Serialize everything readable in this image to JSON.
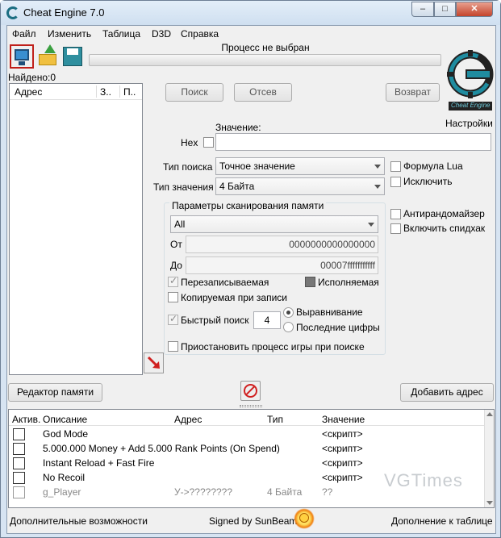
{
  "window": {
    "title": "Cheat Engine 7.0",
    "min": "–",
    "max": "□",
    "close": "✕"
  },
  "menu": [
    "Файл",
    "Изменить",
    "Таблица",
    "D3D",
    "Справка"
  ],
  "process_label": "Процесс не выбран",
  "found_label": "Найдено:0",
  "logo_text": "Cheat Engine",
  "settings_label": "Настройки",
  "results_headers": [
    "Адрес",
    "З..",
    "П.."
  ],
  "buttons": {
    "scan": "Поиск",
    "filter": "Отсев",
    "undo": "Возврат",
    "memory_view": "Редактор памяти",
    "add_address": "Добавить адрес"
  },
  "value": {
    "label": "Значение:",
    "hex_label": "Hex",
    "current": ""
  },
  "scan_type": {
    "label": "Тип поиска",
    "selected": "Точное значение"
  },
  "value_type": {
    "label": "Тип значения",
    "selected": "4 Байта"
  },
  "options_right": {
    "lua_formula": "Формула Lua",
    "not": "Исключить",
    "unrandomizer": "Антирандомайзер",
    "speedhack": "Включить спидхак"
  },
  "scan_params": {
    "title": "Параметры сканирования памяти",
    "region": "All",
    "from_label": "От",
    "from_value": "0000000000000000",
    "to_label": "До",
    "to_value": "00007fffffffffff",
    "writable": "Перезаписываемая",
    "executable": "Исполняемая",
    "copy_on_write": "Копируемая при записи",
    "fast_scan": "Быстрый поиск",
    "fast_scan_value": "4",
    "alignment": "Выравнивание",
    "last_digits": "Последние цифры",
    "pause": "Приостановить процесс игры при поиске"
  },
  "table_headers": {
    "active": "Актив.",
    "description": "Описание",
    "address": "Адрес",
    "type": "Тип",
    "value": "Значение"
  },
  "table_rows": [
    {
      "description": "God Mode",
      "address": "",
      "type": "",
      "value": "<скрипт>"
    },
    {
      "description": "5.000.000 Money + Add 5.000 Rank Points (On Spend)",
      "address": "",
      "type": "",
      "value": "<скрипт>"
    },
    {
      "description": "Instant Reload + Fast Fire",
      "address": "",
      "type": "",
      "value": "<скрипт>"
    },
    {
      "description": "No Recoil",
      "address": "",
      "type": "",
      "value": "<скрипт>"
    },
    {
      "description": "g_Player",
      "address": "У->????????",
      "type": "4 Байта",
      "value": "??"
    }
  ],
  "status": {
    "advanced": "Дополнительные возможности",
    "signed": "Signed by SunBeam",
    "table_extras": "Дополнение к таблице"
  },
  "watermark": "VGTimes"
}
